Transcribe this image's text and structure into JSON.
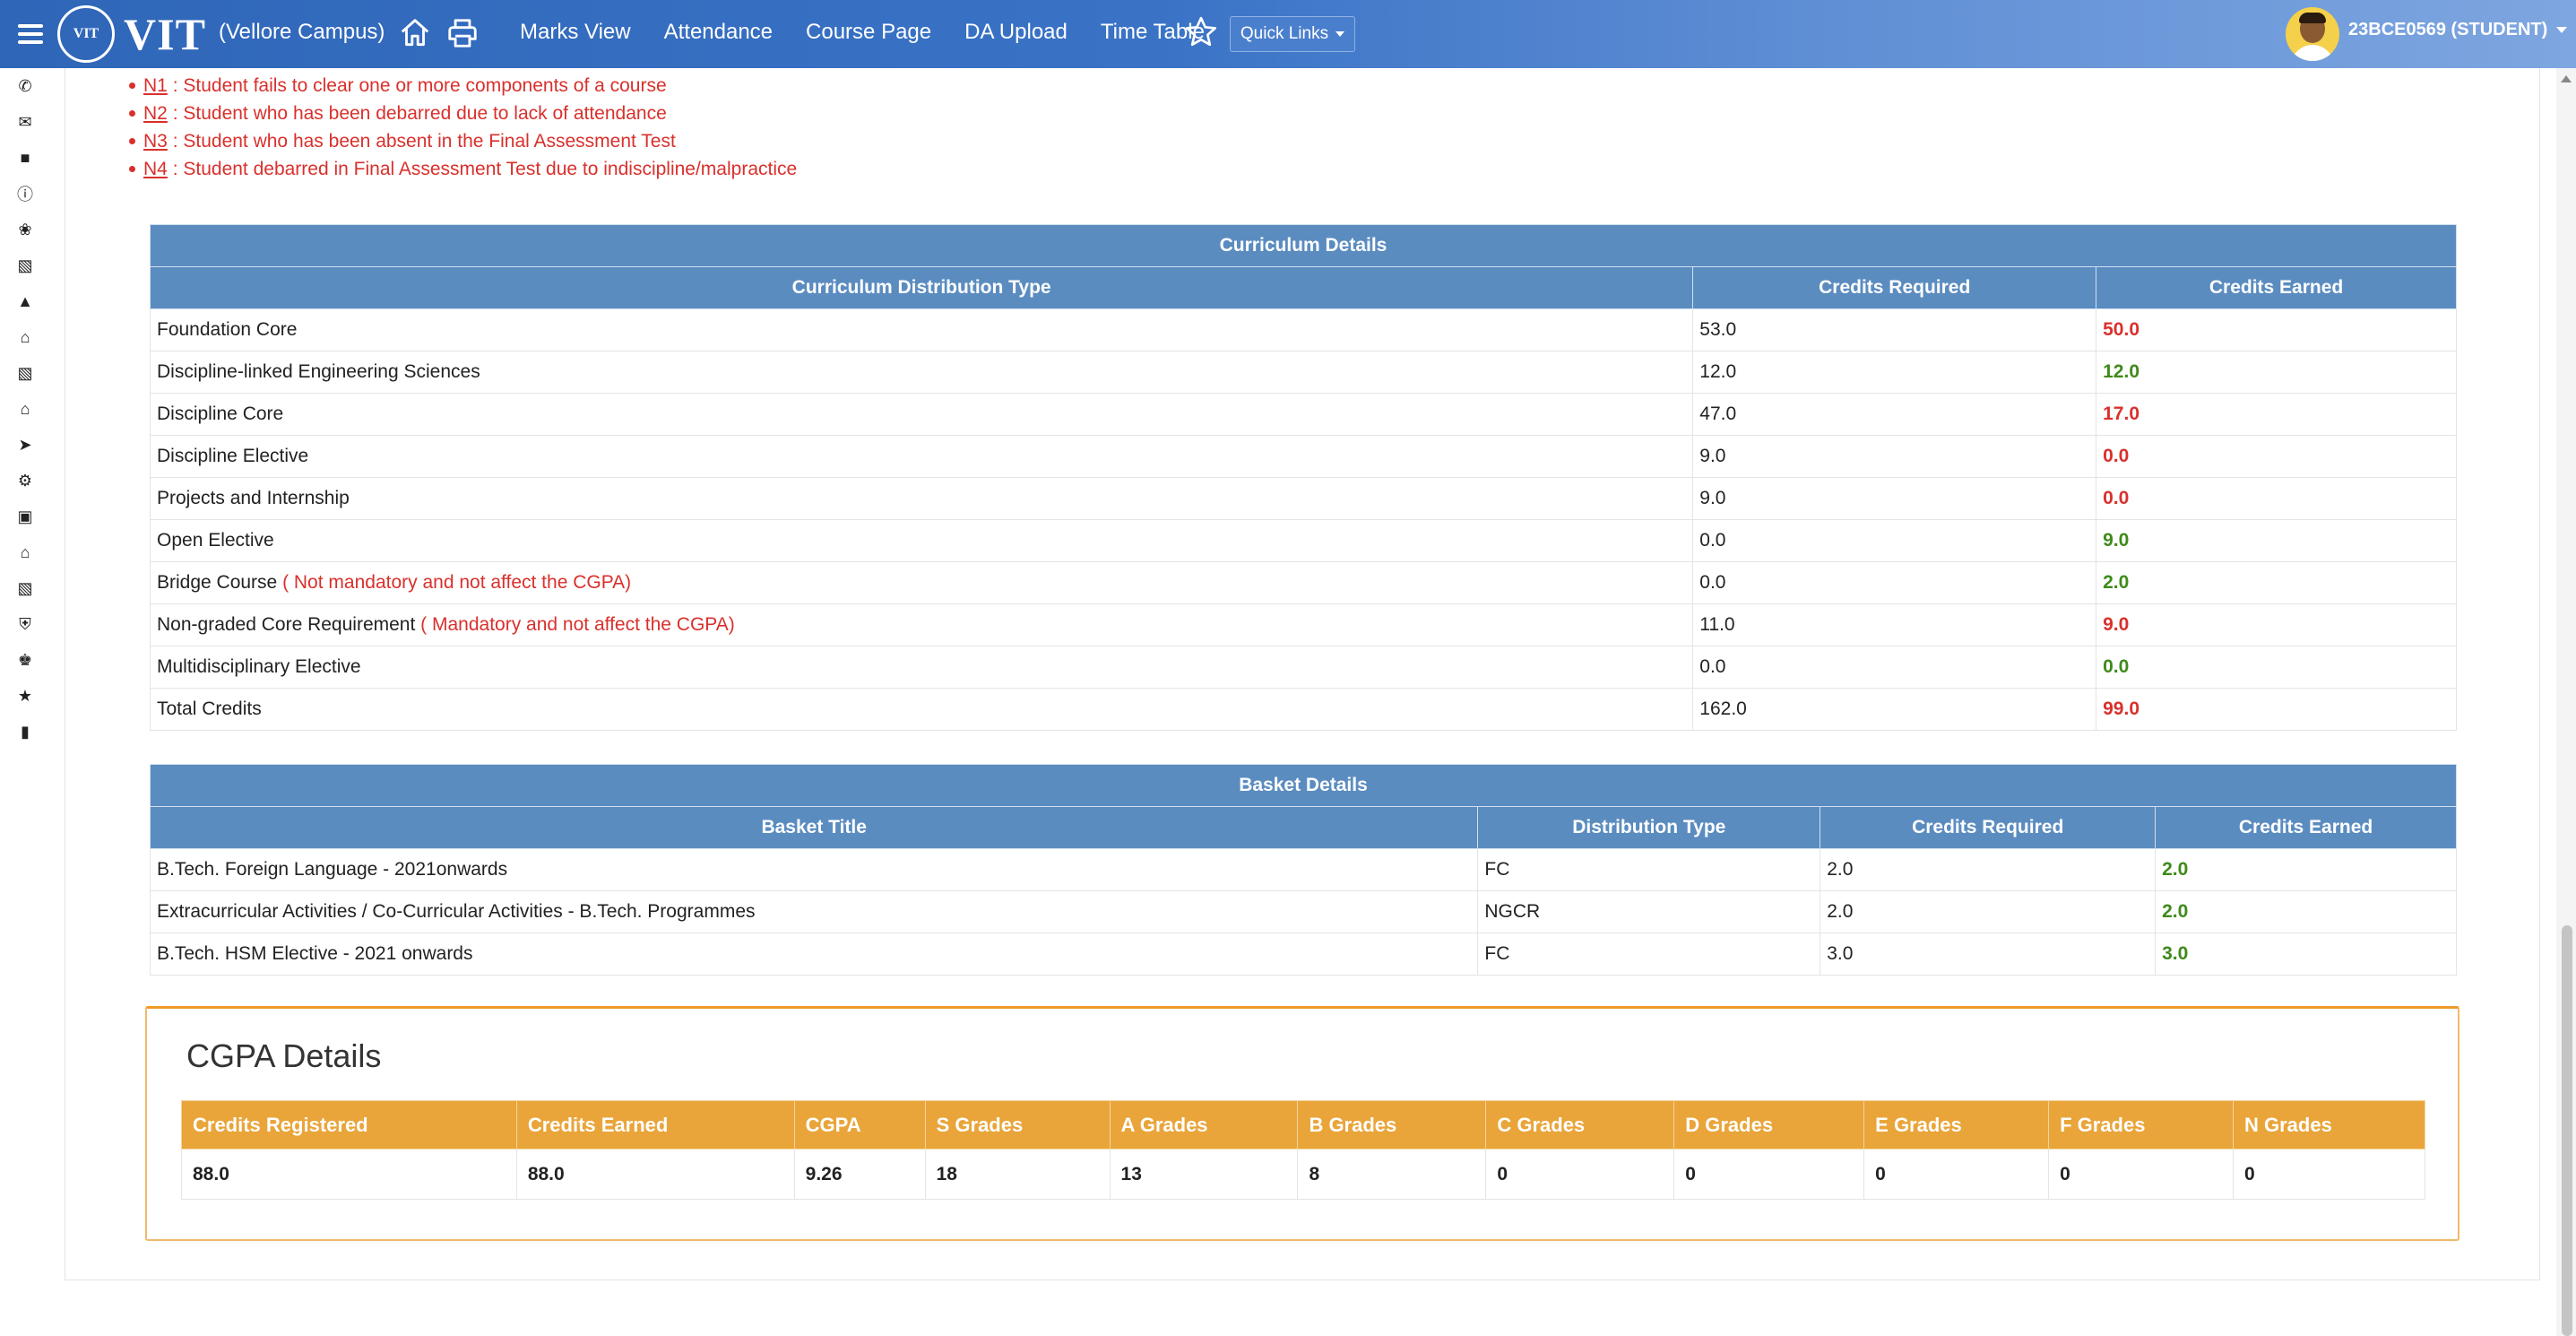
{
  "header": {
    "logo_text": "VIT",
    "campus": "(Vellore Campus)",
    "nav": [
      "Marks View",
      "Attendance",
      "Course Page",
      "DA Upload",
      "Time Table"
    ],
    "quick_links": "Quick Links",
    "user": "23BCE0569 (STUDENT)"
  },
  "rail_icons": [
    "phone-icon",
    "envelope-icon",
    "briefcase-icon",
    "info-icon",
    "paw-icon",
    "book-icon",
    "graduation-cap-icon",
    "bank-icon",
    "book-icon",
    "bank-icon",
    "plane-icon",
    "gear-icon",
    "money-icon",
    "home-icon",
    "book-icon",
    "shield-icon",
    "trophy-icon",
    "star-icon",
    "lock-icon"
  ],
  "legend": [
    {
      "code": "N1",
      "text": " : Student fails to clear one or more components of a course"
    },
    {
      "code": "N2",
      "text": " : Student who has been debarred due to lack of attendance"
    },
    {
      "code": "N3",
      "text": " : Student who has been absent in the Final Assessment Test"
    },
    {
      "code": "N4",
      "text": " : Student debarred in Final Assessment Test due to indiscipline/malpractice"
    }
  ],
  "curriculum": {
    "title": "Curriculum Details",
    "headers": [
      "Curriculum Distribution Type",
      "Credits Required",
      "Credits Earned"
    ],
    "rows": [
      {
        "type": "Foundation Core",
        "note": "",
        "required": "53.0",
        "earned": "50.0",
        "status": "red"
      },
      {
        "type": "Discipline-linked Engineering Sciences",
        "note": "",
        "required": "12.0",
        "earned": "12.0",
        "status": "green"
      },
      {
        "type": "Discipline Core",
        "note": "",
        "required": "47.0",
        "earned": "17.0",
        "status": "red"
      },
      {
        "type": "Discipline Elective",
        "note": "",
        "required": "9.0",
        "earned": "0.0",
        "status": "red"
      },
      {
        "type": "Projects and Internship",
        "note": "",
        "required": "9.0",
        "earned": "0.0",
        "status": "red"
      },
      {
        "type": "Open Elective",
        "note": "",
        "required": "0.0",
        "earned": "9.0",
        "status": "green"
      },
      {
        "type": "Bridge Course",
        "note": " ( Not mandatory and not affect the CGPA)",
        "required": "0.0",
        "earned": "2.0",
        "status": "green"
      },
      {
        "type": "Non-graded Core Requirement",
        "note": " ( Mandatory and not affect the CGPA)",
        "required": "11.0",
        "earned": "9.0",
        "status": "red"
      },
      {
        "type": "Multidisciplinary Elective",
        "note": "",
        "required": "0.0",
        "earned": "0.0",
        "status": "green"
      },
      {
        "type": "Total Credits",
        "note": "",
        "required": "162.0",
        "earned": "99.0",
        "status": "red"
      }
    ]
  },
  "basket": {
    "title": "Basket Details",
    "headers": [
      "Basket Title",
      "Distribution Type",
      "Credits Required",
      "Credits Earned"
    ],
    "rows": [
      {
        "title": "B.Tech. Foreign Language - 2021onwards",
        "dist": "FC",
        "required": "2.0",
        "earned": "2.0"
      },
      {
        "title": "Extracurricular Activities / Co-Curricular Activities - B.Tech. Programmes",
        "dist": "NGCR",
        "required": "2.0",
        "earned": "2.0"
      },
      {
        "title": "B.Tech. HSM Elective - 2021 onwards",
        "dist": "FC",
        "required": "3.0",
        "earned": "3.0"
      }
    ]
  },
  "cgpa": {
    "title": "CGPA Details",
    "headers": [
      "Credits Registered",
      "Credits Earned",
      "CGPA",
      "S Grades",
      "A Grades",
      "B Grades",
      "C Grades",
      "D Grades",
      "E Grades",
      "F Grades",
      "N Grades"
    ],
    "values": [
      "88.0",
      "88.0",
      "9.26",
      "18",
      "13",
      "8",
      "0",
      "0",
      "0",
      "0",
      "0"
    ]
  },
  "colors": {
    "red": "#d9302c",
    "green": "#3f8a1a",
    "table_header": "#5b8cc0",
    "cgpa_header": "#e9a53a"
  }
}
